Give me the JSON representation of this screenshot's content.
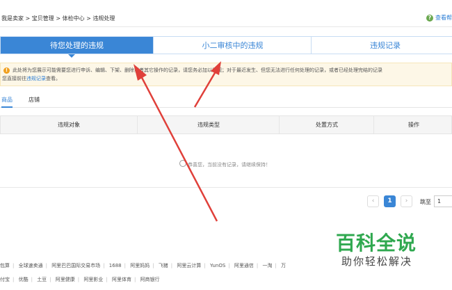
{
  "breadcrumb": "我是卖家 > 宝贝管理 > 体检中心 > 违规处理",
  "help": {
    "icon": "question-icon",
    "label": "查看帮"
  },
  "tabs": [
    {
      "label": "待您处理的违规",
      "active": true
    },
    {
      "label": "小二审核中的违规",
      "active": false
    },
    {
      "label": "违规记录",
      "active": false
    }
  ],
  "notice": {
    "icon": "warning-icon",
    "line1": "此处将为您展示可能需要您进行申诉、编辑、下架、删除或者其它操作的记录，请您务必加以重视；对于最近发生、但您无法进行任何处理的记录，或者已经处理完结的记录",
    "line2_prefix": "您直接前往",
    "line2_link": "违规记录",
    "line2_suffix": "查看。"
  },
  "subtabs": [
    {
      "label": "商品",
      "active": true
    },
    {
      "label": "店铺",
      "active": false
    }
  ],
  "table": {
    "columns": [
      "违规对象",
      "违规类型",
      "处置方式",
      "操作"
    ],
    "empty_text": "恭喜您，当前没有记录，请继续保持！"
  },
  "pagination": {
    "prev": "‹",
    "current": "1",
    "next": "›",
    "jump_label": "跳至",
    "jump_value": "1"
  },
  "footer": {
    "line1": [
      "包算",
      "全球速卖通",
      "阿里巴巴国际交易市场",
      "1688",
      "阿里妈妈",
      "飞猪",
      "阿里云计算",
      "YunOS",
      "阿里通信",
      "一淘",
      "万"
    ],
    "line2": [
      "付宝",
      "优酷",
      "土豆",
      "阿里健康",
      "阿里影业",
      "阿里体育",
      "阿商银行"
    ]
  },
  "watermark": {
    "title": "百科全说",
    "subtitle": "助你轻松解决"
  },
  "colors": {
    "accent": "#3a86d6",
    "annotation": "#e0403a",
    "notice_bg": "#fdf7e7"
  }
}
